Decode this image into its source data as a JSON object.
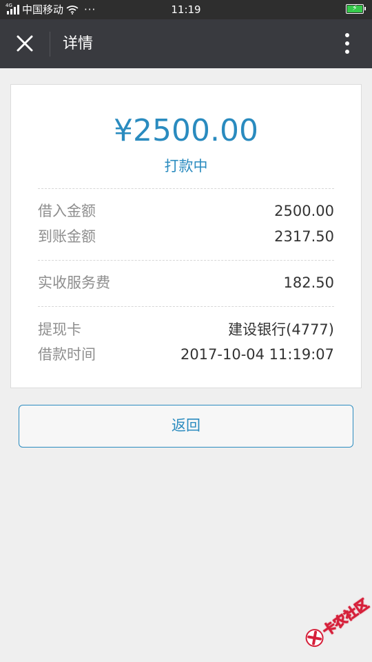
{
  "status_bar": {
    "network": "4G",
    "carrier": "中国移动",
    "more": "···",
    "time": "11:19"
  },
  "nav": {
    "title": "详情"
  },
  "detail": {
    "amount": "¥2500.00",
    "status": "打款中",
    "group1": [
      {
        "label": "借入金额",
        "value": "2500.00"
      },
      {
        "label": "到账金额",
        "value": "2317.50"
      }
    ],
    "group2": [
      {
        "label": "实收服务费",
        "value": "182.50"
      }
    ],
    "group3": [
      {
        "label": "提现卡",
        "value": "建设银行(4777)"
      },
      {
        "label": "借款时间",
        "value": "2017-10-04 11:19:07"
      }
    ]
  },
  "actions": {
    "back_label": "返回"
  },
  "watermark": {
    "text": "卡农社区"
  },
  "colors": {
    "accent": "#2a8bbf",
    "nav_bg": "#393a3f",
    "statusbar_bg": "#2e2e2e",
    "page_bg": "#efefef",
    "battery": "#35c94a"
  }
}
